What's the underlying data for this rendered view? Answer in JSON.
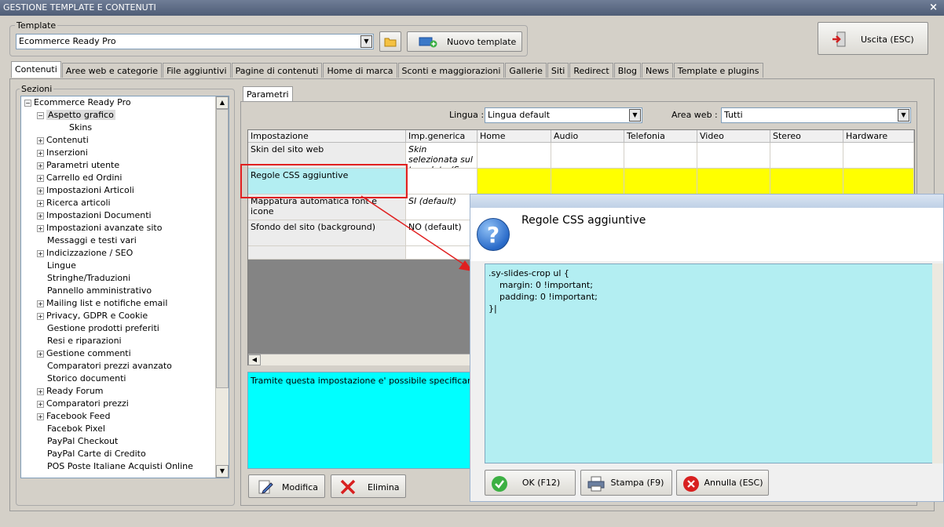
{
  "window": {
    "title": "GESTIONE TEMPLATE E CONTENUTI",
    "close": "×"
  },
  "template": {
    "group_label": "Template",
    "selected": "Ecommerce Ready Pro",
    "new_button": "Nuovo template",
    "exit_button": "Uscita (ESC)"
  },
  "tabs": [
    "Contenuti",
    "Aree web e categorie",
    "File aggiuntivi",
    "Pagine di contenuti",
    "Home di marca",
    "Sconti e maggiorazioni",
    "Gallerie",
    "Siti",
    "Redirect",
    "Blog",
    "News",
    "Template e plugins"
  ],
  "sections": {
    "label": "Sezioni",
    "root": "Ecommerce Ready Pro",
    "items": [
      {
        "label": "Aspetto grafico",
        "exp": "−",
        "selected": true
      },
      {
        "label": "Skins",
        "exp": "",
        "child": true
      },
      {
        "label": "Contenuti",
        "exp": "+"
      },
      {
        "label": "Inserzioni",
        "exp": "+"
      },
      {
        "label": "Parametri utente",
        "exp": "+"
      },
      {
        "label": "Carrello ed Ordini",
        "exp": "+"
      },
      {
        "label": "Impostazioni Articoli",
        "exp": "+"
      },
      {
        "label": "Ricerca articoli",
        "exp": "+"
      },
      {
        "label": "Impostazioni Documenti",
        "exp": "+"
      },
      {
        "label": "Impostazioni avanzate sito",
        "exp": "+"
      },
      {
        "label": "Messaggi e testi vari",
        "exp": ""
      },
      {
        "label": "Indicizzazione / SEO",
        "exp": "+"
      },
      {
        "label": "Lingue",
        "exp": ""
      },
      {
        "label": "Stringhe/Traduzioni",
        "exp": ""
      },
      {
        "label": "Pannello amministrativo",
        "exp": ""
      },
      {
        "label": "Mailing list e notifiche email",
        "exp": "+"
      },
      {
        "label": "Privacy, GDPR e Cookie",
        "exp": "+"
      },
      {
        "label": "Gestione prodotti preferiti",
        "exp": ""
      },
      {
        "label": "Resi e riparazioni",
        "exp": ""
      },
      {
        "label": "Gestione commenti",
        "exp": "+"
      },
      {
        "label": "Comparatori prezzi avanzato",
        "exp": ""
      },
      {
        "label": "Storico documenti",
        "exp": ""
      },
      {
        "label": "Ready Forum",
        "exp": "+"
      },
      {
        "label": "Comparatori prezzi",
        "exp": "+"
      },
      {
        "label": "Facebook Feed",
        "exp": "+"
      },
      {
        "label": "Facebok Pixel",
        "exp": ""
      },
      {
        "label": "PayPal Checkout",
        "exp": ""
      },
      {
        "label": "PayPal Carte di Credito",
        "exp": ""
      },
      {
        "label": "POS Poste Italiane Acquisti Online",
        "exp": ""
      }
    ]
  },
  "params": {
    "tab": "Parametri",
    "lingua_label": "Lingua :",
    "lingua_value": "Lingua default",
    "area_label": "Area web :",
    "area_value": "Tutti",
    "columns": [
      "Impostazione",
      "Imp.generica",
      "Home",
      "Audio",
      "Telefonia",
      "Video",
      "Stereo",
      "Hardware"
    ],
    "rows": [
      {
        "name": "Skin del sito web",
        "generic": "Skin selezionata sul template (S..."
      },
      {
        "name": "Regole CSS aggiuntive",
        "generic": ""
      },
      {
        "name": "Mappatura automatica font e icone",
        "generic": "SI (default)"
      },
      {
        "name": "Sfondo del sito (background)",
        "generic": "NO (default)"
      }
    ],
    "description": "Tramite questa impostazione e' possibile specificare delle re",
    "edit_button": "Modifica",
    "delete_button": "Elimina"
  },
  "dialog": {
    "title": "Regole CSS aggiuntive",
    "css_text": ".sy-slides-crop ul {\n    margin: 0 !important;\n    padding: 0 !important;\n}|",
    "ok_button": "OK (F12)",
    "print_button": "Stampa (F9)",
    "cancel_button": "Annulla (ESC)"
  },
  "colors": {
    "highlight_row": "#ffff00",
    "css_bg": "#b3eef2",
    "desc_bg": "#00ffff",
    "annotation": "#e02020"
  }
}
